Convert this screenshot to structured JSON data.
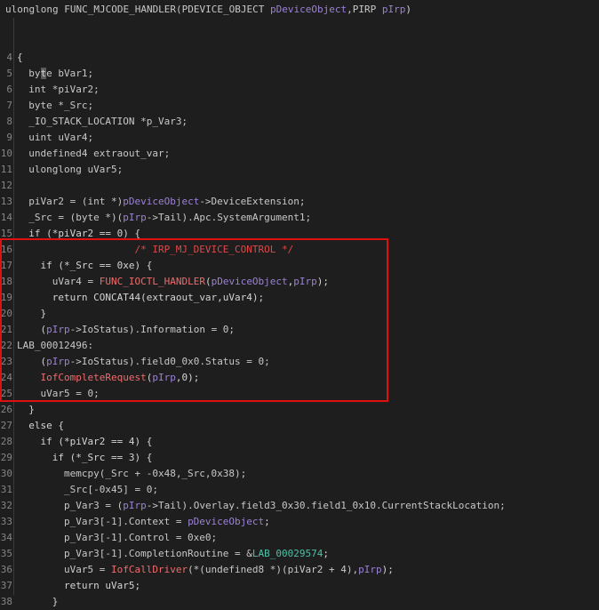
{
  "signature": [
    {
      "t": "ulonglong FUNC_MJCODE_HANDLER(PDEVICE_OBJECT ",
      "c": "t-type"
    },
    {
      "t": "pDeviceObject",
      "c": "t-param"
    },
    {
      "t": ",PIRP ",
      "c": "t-type"
    },
    {
      "t": "pIrp",
      "c": "t-param"
    },
    {
      "t": ")",
      "c": "t-op"
    }
  ],
  "lines": [
    {
      "n": "",
      "i": 0,
      "tok": []
    },
    {
      "n": "4",
      "i": 0,
      "tok": [
        {
          "t": "{",
          "c": "t-op"
        }
      ]
    },
    {
      "n": "5",
      "i": 1,
      "tok": [
        {
          "t": "by",
          "c": "t-type"
        },
        {
          "t": "t",
          "c": "t-hl"
        },
        {
          "t": "e bVar1;",
          "c": "t-type"
        }
      ]
    },
    {
      "n": "6",
      "i": 1,
      "tok": [
        {
          "t": "int *piVar2;",
          "c": "t-type"
        }
      ]
    },
    {
      "n": "7",
      "i": 1,
      "tok": [
        {
          "t": "byte *_Src;",
          "c": "t-type"
        }
      ]
    },
    {
      "n": "8",
      "i": 1,
      "tok": [
        {
          "t": "_IO_STACK_LOCATION *p_Var3;",
          "c": "t-type"
        }
      ]
    },
    {
      "n": "9",
      "i": 1,
      "tok": [
        {
          "t": "uint uVar4;",
          "c": "t-type"
        }
      ]
    },
    {
      "n": "10",
      "i": 1,
      "tok": [
        {
          "t": "undefined4 extraout_var;",
          "c": "t-type"
        }
      ]
    },
    {
      "n": "11",
      "i": 1,
      "tok": [
        {
          "t": "ulonglong uVar5;",
          "c": "t-type"
        }
      ]
    },
    {
      "n": "12",
      "i": 0,
      "tok": []
    },
    {
      "n": "13",
      "i": 1,
      "tok": [
        {
          "t": "piVar2 = (int *)",
          "c": "t-var"
        },
        {
          "t": "pDeviceObject",
          "c": "t-param"
        },
        {
          "t": "->DeviceExtension;",
          "c": "t-var"
        }
      ]
    },
    {
      "n": "14",
      "i": 1,
      "tok": [
        {
          "t": "_Src = (byte *)(",
          "c": "t-var"
        },
        {
          "t": "pIrp",
          "c": "t-param"
        },
        {
          "t": "->Tail).Apc.SystemArgument1;",
          "c": "t-var"
        }
      ]
    },
    {
      "n": "15",
      "i": 1,
      "tok": [
        {
          "t": "if (*piVar2 == 0) {",
          "c": "t-kw"
        }
      ]
    },
    {
      "n": "16",
      "i": 0,
      "tok": [
        {
          "t": "                    /* IRP_MJ_DEVICE_CONTROL */",
          "c": "t-cmt"
        }
      ]
    },
    {
      "n": "17",
      "i": 2,
      "tok": [
        {
          "t": "if (*_Src == 0xe) {",
          "c": "t-kw"
        }
      ]
    },
    {
      "n": "18",
      "i": 3,
      "tok": [
        {
          "t": "uVar4 = ",
          "c": "t-var"
        },
        {
          "t": "FUNC_IOCTL_HANDLER",
          "c": "t-func"
        },
        {
          "t": "(",
          "c": "t-op"
        },
        {
          "t": "pDeviceObject",
          "c": "t-param"
        },
        {
          "t": ",",
          "c": "t-op"
        },
        {
          "t": "pIrp",
          "c": "t-param"
        },
        {
          "t": ");",
          "c": "t-op"
        }
      ]
    },
    {
      "n": "19",
      "i": 3,
      "tok": [
        {
          "t": "return CONCAT44(extraout_var,uVar4);",
          "c": "t-kw"
        }
      ]
    },
    {
      "n": "20",
      "i": 2,
      "tok": [
        {
          "t": "}",
          "c": "t-op"
        }
      ]
    },
    {
      "n": "21",
      "i": 2,
      "tok": [
        {
          "t": "(",
          "c": "t-op"
        },
        {
          "t": "pIrp",
          "c": "t-param"
        },
        {
          "t": "->IoStatus).Information = 0;",
          "c": "t-var"
        }
      ]
    },
    {
      "n": "22",
      "i": 0,
      "tok": [
        {
          "t": "LAB_00012496:",
          "c": "t-type"
        }
      ]
    },
    {
      "n": "23",
      "i": 2,
      "tok": [
        {
          "t": "(",
          "c": "t-op"
        },
        {
          "t": "pIrp",
          "c": "t-param"
        },
        {
          "t": "->IoStatus).field0_0x0.Status = 0;",
          "c": "t-var"
        }
      ]
    },
    {
      "n": "24",
      "i": 2,
      "tok": [
        {
          "t": "IofCompleteRequest",
          "c": "t-func"
        },
        {
          "t": "(",
          "c": "t-op"
        },
        {
          "t": "pIrp",
          "c": "t-param"
        },
        {
          "t": ",0);",
          "c": "t-op"
        }
      ]
    },
    {
      "n": "25",
      "i": 2,
      "tok": [
        {
          "t": "uVar5 = 0;",
          "c": "t-var"
        }
      ]
    },
    {
      "n": "26",
      "i": 1,
      "tok": [
        {
          "t": "}",
          "c": "t-op"
        }
      ]
    },
    {
      "n": "27",
      "i": 1,
      "tok": [
        {
          "t": "else {",
          "c": "t-kw"
        }
      ]
    },
    {
      "n": "28",
      "i": 2,
      "tok": [
        {
          "t": "if (*piVar2 == 4) {",
          "c": "t-kw"
        }
      ]
    },
    {
      "n": "29",
      "i": 3,
      "tok": [
        {
          "t": "if (*_Src == 3) {",
          "c": "t-kw"
        }
      ]
    },
    {
      "n": "30",
      "i": 4,
      "tok": [
        {
          "t": "memcpy(_Src + -0x48,_Src,0x38);",
          "c": "t-var"
        }
      ]
    },
    {
      "n": "31",
      "i": 4,
      "tok": [
        {
          "t": "_Src[-0x45] = 0;",
          "c": "t-var"
        }
      ]
    },
    {
      "n": "32",
      "i": 4,
      "tok": [
        {
          "t": "p_Var3 = (",
          "c": "t-var"
        },
        {
          "t": "pIrp",
          "c": "t-param"
        },
        {
          "t": "->Tail).Overlay.field3_0x30.field1_0x10.CurrentStackLocation;",
          "c": "t-var"
        }
      ]
    },
    {
      "n": "33",
      "i": 4,
      "tok": [
        {
          "t": "p_Var3[-1].Context = ",
          "c": "t-var"
        },
        {
          "t": "pDeviceObject",
          "c": "t-param"
        },
        {
          "t": ";",
          "c": "t-op"
        }
      ]
    },
    {
      "n": "34",
      "i": 4,
      "tok": [
        {
          "t": "p_Var3[-1].Control = 0xe0;",
          "c": "t-var"
        }
      ]
    },
    {
      "n": "35",
      "i": 4,
      "tok": [
        {
          "t": "p_Var3[-1].CompletionRoutine = &",
          "c": "t-var"
        },
        {
          "t": "LAB_00029574",
          "c": "t-label"
        },
        {
          "t": ";",
          "c": "t-op"
        }
      ]
    },
    {
      "n": "36",
      "i": 4,
      "tok": [
        {
          "t": "uVar5 = ",
          "c": "t-var"
        },
        {
          "t": "IofCallDriver",
          "c": "t-func"
        },
        {
          "t": "(*(undefined8 *)(piVar2 + 4),",
          "c": "t-var"
        },
        {
          "t": "pIrp",
          "c": "t-param"
        },
        {
          "t": ");",
          "c": "t-op"
        }
      ]
    },
    {
      "n": "37",
      "i": 4,
      "tok": [
        {
          "t": "return uVar5;",
          "c": "t-kw"
        }
      ]
    },
    {
      "n": "38",
      "i": 3,
      "tok": [
        {
          "t": "}",
          "c": "t-op"
        }
      ]
    }
  ],
  "colors": {
    "background": "#1e1e1e",
    "highlight_box": "#e01010",
    "param": "#9c82d6",
    "function": "#f26b6b",
    "label": "#4ec0a8",
    "comment": "#e04848"
  }
}
